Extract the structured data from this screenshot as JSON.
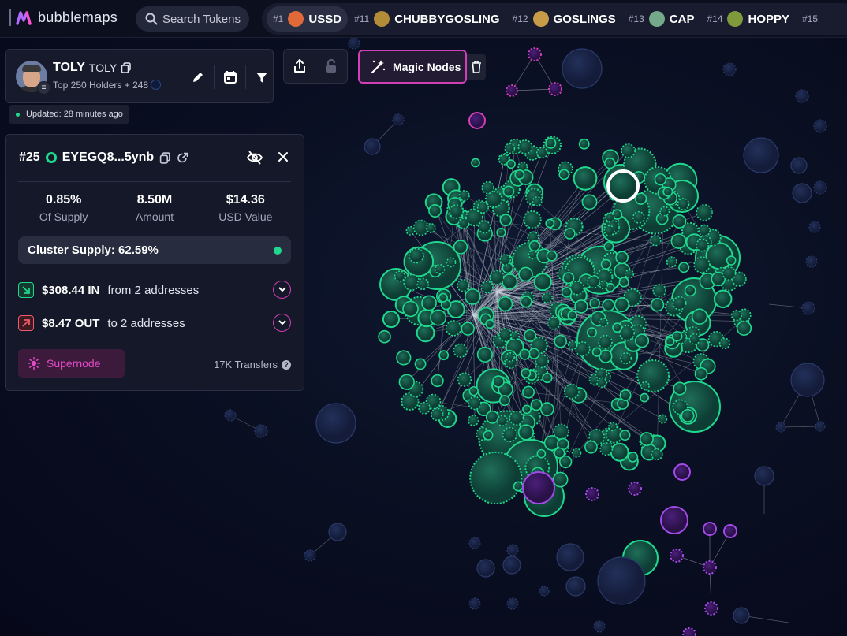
{
  "app": {
    "name": "bubblemaps"
  },
  "search": {
    "placeholder": "Search Tokens"
  },
  "ticker": [
    {
      "rank": "#1",
      "name": "USSD",
      "icon": "ussd-coin-icon",
      "color": "#e0693a",
      "active": true
    },
    {
      "rank": "#11",
      "name": "CHUBBYGOSLING",
      "icon": "goose-icon",
      "color": "#b38c3a",
      "active": false
    },
    {
      "rank": "#12",
      "name": "GOSLINGS",
      "icon": "goslings-icon",
      "color": "#c79b47",
      "active": false
    },
    {
      "rank": "#13",
      "name": "CAP",
      "icon": "cap-icon",
      "color": "#74a98a",
      "active": false
    },
    {
      "rank": "#14",
      "name": "HOPPY",
      "icon": "frog-icon",
      "color": "#7e9a3b",
      "active": false
    },
    {
      "rank": "#15",
      "name": "",
      "icon": "",
      "color": "",
      "active": false
    }
  ],
  "wallet": {
    "name": "TOLY",
    "ticker": "TOLY",
    "meta": "Top 250 Holders + 248",
    "updated": "Updated: 28 minutes ago"
  },
  "magic": {
    "label": "Magic Nodes"
  },
  "holder": {
    "rank": "#25",
    "address": "EYEGQ8...5ynb",
    "stats": [
      {
        "value": "0.85%",
        "label": "Of Supply"
      },
      {
        "value": "8.50M",
        "label": "Amount"
      },
      {
        "value": "$14.36",
        "label": "USD Value"
      }
    ],
    "cluster": "Cluster Supply: 62.59%",
    "inflow": {
      "amount": "$308.44 IN",
      "rest": "from 2 addresses"
    },
    "outflow": {
      "amount": "$8.47 OUT",
      "rest": "to 2 addresses"
    },
    "supernode": "Supernode",
    "transfers": "17K Transfers"
  },
  "colors": {
    "accent": "#d13fb5",
    "green": "#1fd88e",
    "purple": "#9b3be0",
    "muted": "#1c2a4d"
  }
}
